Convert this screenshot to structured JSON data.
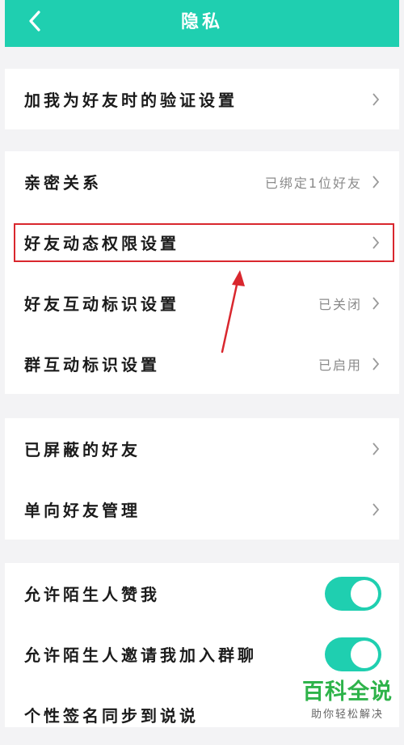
{
  "header": {
    "title": "隐私",
    "back_icon": "chevron-left-icon"
  },
  "groups": [
    {
      "rows": [
        {
          "label": "加我为好友时的验证设置",
          "value": ""
        }
      ]
    },
    {
      "rows": [
        {
          "label": "亲密关系",
          "value": "已绑定1位好友"
        },
        {
          "label": "好友动态权限设置",
          "value": ""
        },
        {
          "label": "好友互动标识设置",
          "value": "已关闭"
        },
        {
          "label": "群互动标识设置",
          "value": "已启用"
        }
      ]
    },
    {
      "rows": [
        {
          "label": "已屏蔽的好友",
          "value": ""
        },
        {
          "label": "单向好友管理",
          "value": ""
        }
      ]
    },
    {
      "rows": [
        {
          "label": "允许陌生人赞我",
          "toggle": true
        },
        {
          "label": "允许陌生人邀请我加入群聊",
          "toggle": true
        },
        {
          "label": "个性签名同步到说说"
        }
      ]
    }
  ],
  "annotation": {
    "highlight_color": "#d9272e"
  },
  "watermark": {
    "main": "百科全说",
    "sub": "助你轻松解决"
  },
  "colors": {
    "accent": "#1fcfb0",
    "background": "#f3f3f5",
    "watermark": "#2eb34a"
  }
}
